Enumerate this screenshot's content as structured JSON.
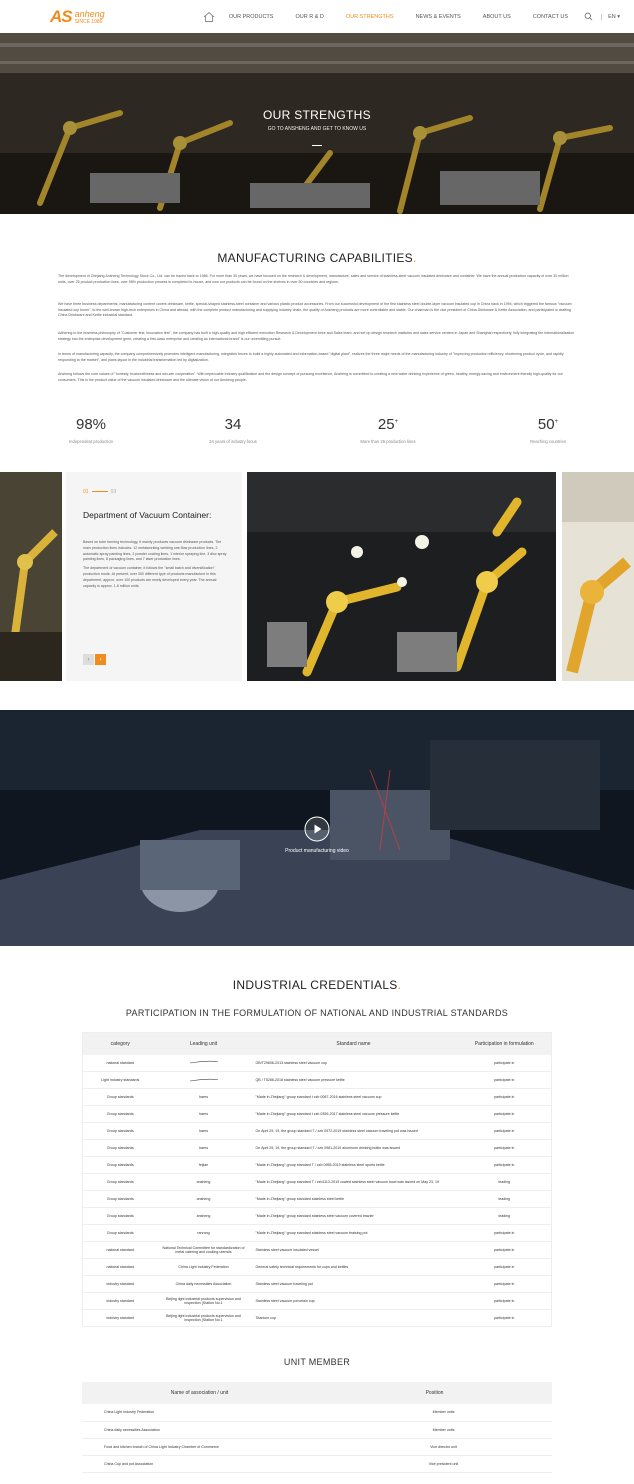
{
  "header": {
    "logo_mark": "AS",
    "logo_brand": "anheng",
    "logo_since": "SINCE 1986",
    "nav": [
      "OUR PRODUCTS",
      "OUR R & D",
      "OUR STRENGTHS",
      "NEWS & EVENTS",
      "ABOUT US",
      "CONTACT US"
    ],
    "active_nav": "OUR STRENGTHS",
    "lang": "EN ▾"
  },
  "hero": {
    "title": "OUR STRENGTHS",
    "subtitle": "GO TO ANSHENG AND GET TO KNOW US"
  },
  "capabilities": {
    "title": "MANUFACTURING CAPABILITIES",
    "paragraphs": [
      "The development of Zhejiang Ansheng Technology Stock Co., Ltd. can be traced back to 1986. For more than 30 years, we have focused on the research & development, manufacture, sales and service of stainless-steel vacuum insulated drinkware and container. We have the annual production capacity of over 30 million units, over 25 product production lines, over 98% production process is completed in-house, and now our products can be found on the shelves in over 50 countries and regions.",
      "We have three business departments, manufacturing content covers drinkware, kettle, special-shaped stainless-steel container and various plastic product accessories. From our successful development of the first stainless steel double-layer vacuum insulated cup in China back in 1994, which triggered the famous \"vacuum insulated cup boom\", to the well-known high-tech enterprises in China and abroad, with the complete product manufacturing and supplying industry chain, the quality of Ansheng products are more controllable and stable. Our chairman is the vice president of China Drinkware & Kettle Association, and participated in drafting China Drinkware and Kettle industrial standard.",
      "Adhering to the business philosophy of \"Customer first, innovation first\", the company has built a high-quality and high efficient execution Research & Development force and Sales team, and set up design research institutes and sales service centers in Japan and Shanghai respectively, fully integrating the internationalization strategy into the enterprise development gene, creating a first-class enterprise and creating an international brand\" is our unremitting pursuit.",
      "In terms of manufacturing capacity, the company comprehensively promotes intelligent manufacturing, integrates forces to build a highly automated and information-based \"digital plant\", realizes the three major needs of the manufacturing industry of \"improving production efficiency, shortening product cycle, and rapidly responding to the market\", and plans layout in the industrial transformation led by digitalization.",
      "Ansheng follows the core values of \"honesty, trustworthiness and win-win cooperation\". With impeccable industry qualification and the design concept of pursuing excellence, Ansheng is committed to creating a new water drinking experience of green, healthy, energy-saving and environment friendly high-quality for our consumers. This is the product value of the vacuum insulated drinkware and the ultimate vision of our Ansheng people."
    ]
  },
  "stats": [
    {
      "value": "98%",
      "sup": "",
      "label": "Independent production"
    },
    {
      "value": "34",
      "sup": "",
      "label": "34 years of industry focus"
    },
    {
      "value": "25",
      "sup": "+",
      "label": "More than 25 production lines"
    },
    {
      "value": "50",
      "sup": "+",
      "label": "Reaching countries"
    }
  ],
  "department": {
    "current": "01",
    "total": "03",
    "title": "Department of Vacuum Container:",
    "paragraphs": [
      "Based on tube forming technology, it mainly produces vacuum drinkware products. The main production lines includes: 12 metalworking-welding one-flow production lines, 2 automatic spray painting lines, 2 powder coating lines, 1 interior spraying line, 3 disc spray painting lines, 8 packaging lines, and 7 laser production lines.",
      "The department of vacuum container, it follows the \"small batch and diversification\" production mode. At present, over 300 different type of products manufacture in this department, approx. over 100 products are newly developed every year. The annual capacity is approx. 1.8 million units."
    ],
    "prev_label": "‹",
    "next_label": "›"
  },
  "video": {
    "caption": "Product manufacturing video"
  },
  "credentials": {
    "title": "INDUSTRIAL CREDENTIALS",
    "standards_title": "PARTICIPATION IN THE FORMULATION OF NATIONAL AND INDUSTRIAL STANDARDS",
    "columns": [
      "category",
      "Leading unit",
      "Standard name",
      "Participation in formulation"
    ],
    "rows": [
      [
        "national standard",
        "",
        "GB/T29606-2013 stainless steel vacuum cup",
        "participate in"
      ],
      [
        "Light industry standards",
        "",
        "QB / T5286-2018 stainless steel vacuum pressure kettle",
        "participate in"
      ],
      [
        "Group standards",
        "haers",
        "\"Made in Zhejiang\" group standard t zzb 0087-2016 stainless steel vacuum cup",
        "participate in"
      ],
      [
        "Group standards",
        "haers",
        "\"Made in Zhejiang\" group standard t zzb 0359-2017 stainless steel vacuum pressure kettle",
        "participate in"
      ],
      [
        "Group standards",
        "haers",
        "On April 29, 19, the group standard T / zzb 0972-2019 stainless steel vacuum traveling pot was issued",
        "participate in"
      ],
      [
        "Group standards",
        "haers",
        "On April 29, 19, the group standard T / zzb 0981-2019 aluminum drinking bottle was issued",
        "participate in"
      ],
      [
        "Group standards",
        "feijian",
        "\"Made in Zhejiang\" group standard T / zzb 0955-2019 stainless steel sports kettle",
        "participate in"
      ],
      [
        "Group standards",
        "ansheng",
        "\"Made in Zhejiang\" group standard T / zzb1113-2019 coated stainless steel vacuum bowl was issued on May 23, 19",
        "leading"
      ],
      [
        "Group standards",
        "ansheng",
        "\"Made in Zhejiang\" group standard stainless steel kettle",
        "leading"
      ],
      [
        "Group standards",
        "ansheng",
        "\"Made in Zhejiang\" group standard stainless steel vacuum covered brazier",
        "leading"
      ],
      [
        "Group standards",
        "ranrong",
        "\"Made in Zhejiang\" group standard stainless steel vacuum braising pot",
        "participate in"
      ],
      [
        "national standard",
        "National Technical Committee for standardization of metal catering and cooking utensils",
        "Stainless steel vacuum insulated vessel",
        "participate in"
      ],
      [
        "national standard",
        "China Light Industry Federation",
        "General safety technical requirements for cups and kettles",
        "participate in"
      ],
      [
        "industry standard",
        "China daily necessities Association",
        "Stainless steel vacuum traveling pot",
        "participate in"
      ],
      [
        "industry standard",
        "Beijing light industrial products supervision and inspection (Station No.1",
        "Stainless steel vacuum porcelain cup",
        "participate in"
      ],
      [
        "industry standard",
        "Beijing light industrial products supervision and inspection (Station No.1",
        "Titanium cup",
        "participate in"
      ]
    ]
  },
  "membership": {
    "title": "UNIT MEMBER",
    "columns": [
      "Name of association / unit",
      "Position"
    ],
    "rows": [
      [
        "China Light Industry Federation",
        "Member units"
      ],
      [
        "China daily necessities Association",
        "Member units"
      ],
      [
        "Food and kitchen branch of China Light Industry Chamber of Commerce",
        "Vice director unit"
      ],
      [
        "China Cup and pot Association",
        "Vice president unit"
      ]
    ]
  },
  "colors": {
    "accent": "#f08c1e",
    "text": "#333333",
    "muted": "#888888"
  }
}
